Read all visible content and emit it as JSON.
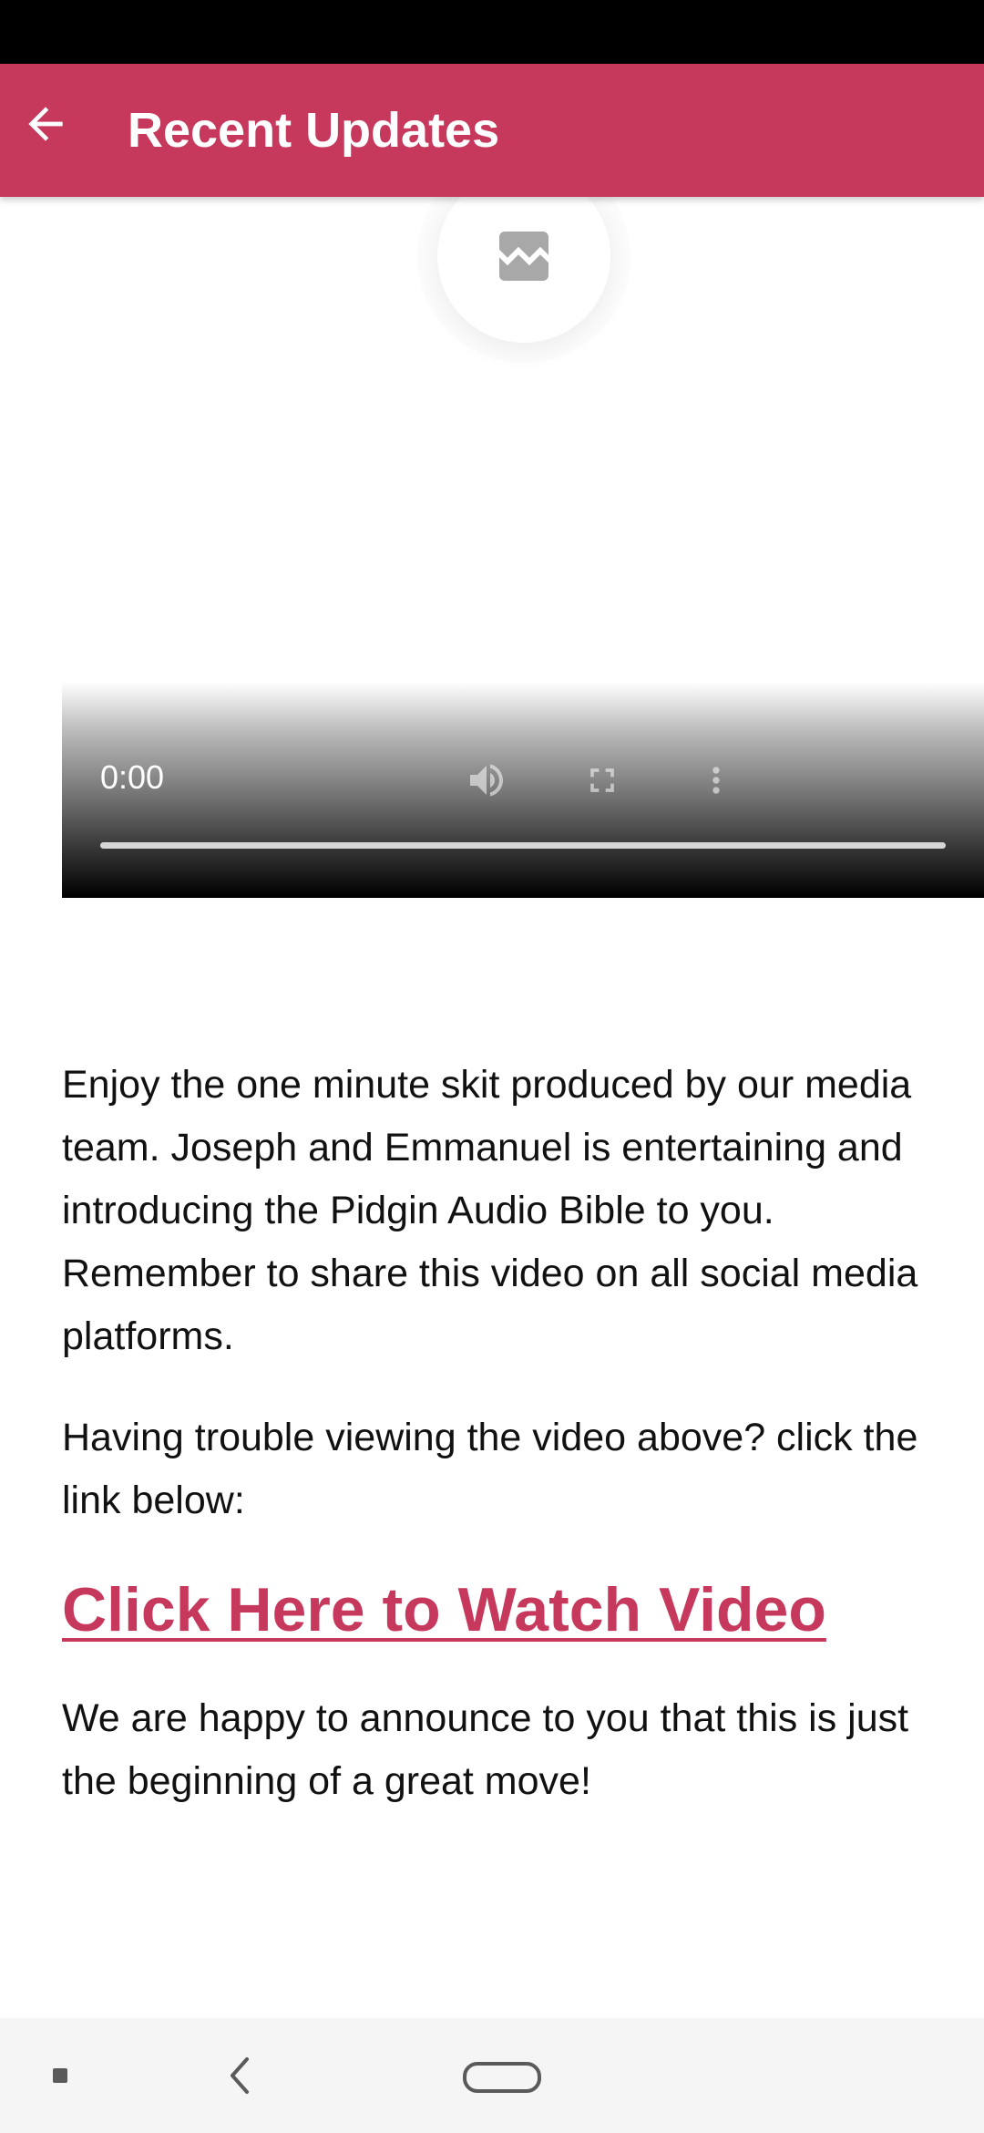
{
  "app_bar": {
    "title": "Recent Updates",
    "back_icon": "arrow-left-icon",
    "background": "#c6395d"
  },
  "image_placeholder": {
    "icon": "broken-image-icon"
  },
  "video_player": {
    "current_time": "0:00",
    "progress": 0,
    "controls": [
      "volume-icon",
      "fullscreen-icon",
      "more-vert-icon"
    ]
  },
  "article": {
    "paragraph_1": "Enjoy the one minute skit produced by our media team. Joseph and Emmanuel is entertaining and introducing the Pidgin Audio Bible to you. Remember to share this video on all social media platforms.",
    "paragraph_2": "Having trouble viewing the video above? click the link below:",
    "link_text": "Click Here to Watch Video",
    "link_color": "#c6395d",
    "paragraph_3": "We are happy to announce to you that this is just the beginning of a great move!"
  },
  "system_nav": {
    "buttons": [
      "recent-apps-icon",
      "back-icon",
      "home-icon"
    ]
  }
}
